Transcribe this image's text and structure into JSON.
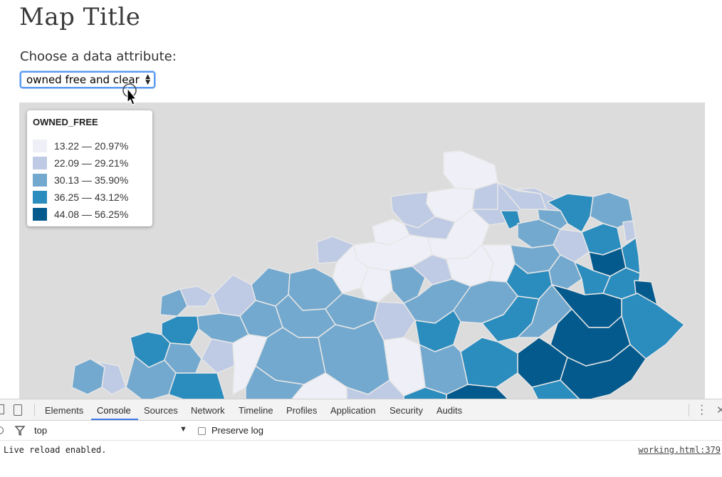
{
  "page": {
    "title": "Map Title",
    "attr_label": "Choose a data attribute:",
    "select_value": "owned free and clear"
  },
  "legend": {
    "title": "OWNED_FREE",
    "items": [
      {
        "label": "13.22 — 20.97%",
        "color": "#eff0f7"
      },
      {
        "label": "22.09 — 29.21%",
        "color": "#bfcbe4"
      },
      {
        "label": "30.13 — 35.90%",
        "color": "#74a9cf"
      },
      {
        "label": "36.25 — 43.12%",
        "color": "#2b8cbe"
      },
      {
        "label": "44.08 — 56.25%",
        "color": "#045a8d"
      }
    ]
  },
  "devtools": {
    "tabs": [
      "Elements",
      "Console",
      "Sources",
      "Network",
      "Timeline",
      "Profiles",
      "Application",
      "Security",
      "Audits"
    ],
    "active_tab": "Console",
    "context": "top",
    "preserve_log": "Preserve log",
    "message": "Live reload enabled.",
    "source": "working.html:379"
  },
  "colors": {
    "map_background": "#dcdcdc",
    "select_focus": "#5b9bf0",
    "active_tab_underline": "#3b78e7"
  }
}
